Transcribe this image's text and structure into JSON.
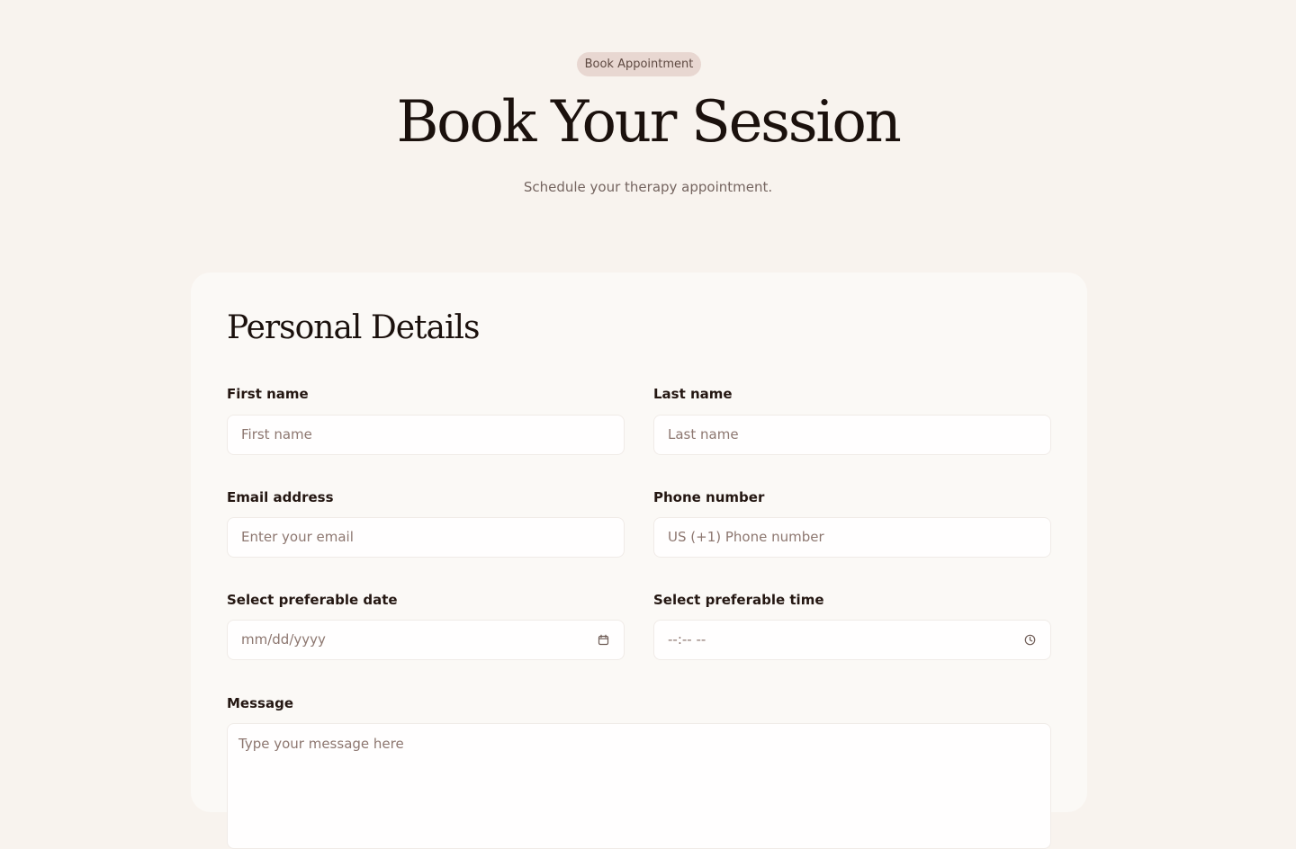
{
  "header": {
    "badge": "Book Appointment",
    "title": "Book Your Session",
    "subtitle": "Schedule your therapy appointment."
  },
  "form": {
    "section_title": "Personal Details",
    "first_name": {
      "label": "First name",
      "placeholder": "First name"
    },
    "last_name": {
      "label": "Last name",
      "placeholder": "Last name"
    },
    "email": {
      "label": "Email address",
      "placeholder": "Enter your email"
    },
    "phone": {
      "label": "Phone number",
      "placeholder": "US (+1) Phone number"
    },
    "date": {
      "label": "Select preferable date",
      "placeholder": "mm/dd/yyyy",
      "icon": "calendar-icon"
    },
    "time": {
      "label": "Select preferable time",
      "placeholder": "--:-- --",
      "icon": "clock-icon"
    },
    "message": {
      "label": "Message",
      "placeholder": "Type your message here"
    }
  },
  "colors": {
    "background": "#f8f3ee",
    "card": "#fbf9f6",
    "badge": "#e8d7d1",
    "text": "#1b110d",
    "placeholder": "#8d7770"
  }
}
